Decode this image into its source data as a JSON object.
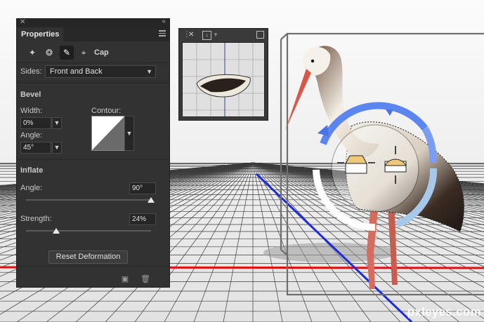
{
  "panel": {
    "title": "Properties",
    "tabs": [
      "deform-icon",
      "cap-icon",
      "inflate-icon",
      "coordinates-icon"
    ],
    "cap_label": "Cap",
    "sides": {
      "label": "Sides:",
      "value": "Front and Back"
    },
    "bevel": {
      "header": "Bevel",
      "width_label": "Width:",
      "width_value": "0%",
      "angle_label": "Angle:",
      "angle_value": "45°",
      "contour_label": "Contour:"
    },
    "inflate": {
      "header": "Inflate",
      "angle_label": "Angle:",
      "angle_value": "90°",
      "angle_fraction": 1.0,
      "strength_label": "Strength:",
      "strength_value": "24%",
      "strength_fraction": 0.24
    },
    "reset_label": "Reset Deformation"
  },
  "navigator": {
    "icons": [
      "collapse-icon",
      "close-icon",
      "render-icon",
      "dropdown-icon",
      "resize-icon"
    ]
  },
  "watermark": "pxleyes.com",
  "colors": {
    "x_axis": "#e11010",
    "z_axis": "#1c2cdc",
    "widget": "#5b86f0",
    "widget_light": "#a8c8ea"
  }
}
